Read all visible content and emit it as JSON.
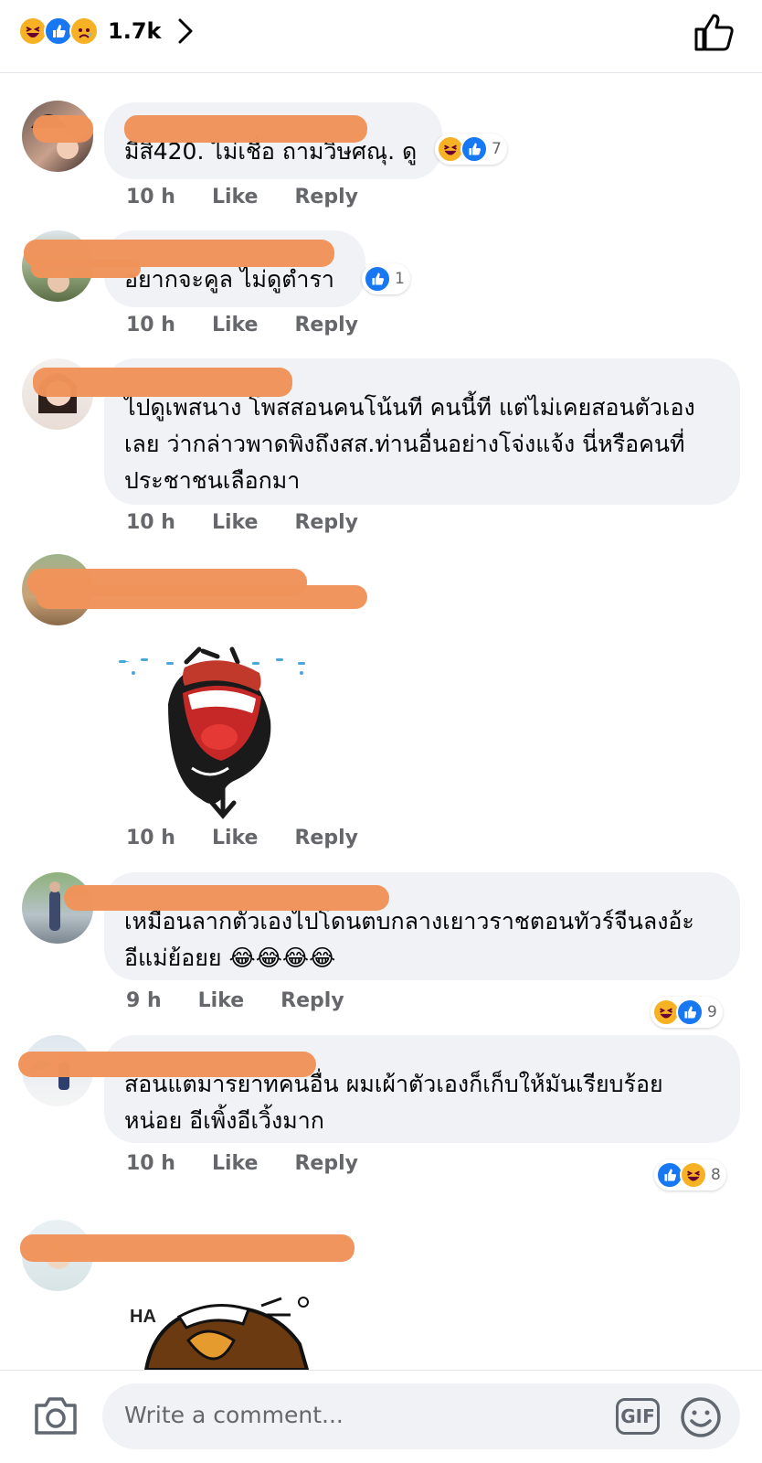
{
  "header": {
    "reaction_icons": [
      "haha-icon",
      "like-icon",
      "sad-icon"
    ],
    "reaction_count": "1.7k"
  },
  "comments": [
    {
      "text": "มีสิ420. ไม่เชื่อ ถามวิษศณุ. ดู",
      "time": "10 h",
      "like": "Like",
      "reply": "Reply",
      "reactions": [
        "haha-icon",
        "like-icon"
      ],
      "reaction_count": "7"
    },
    {
      "text": "อยากจะคูล ไม่ดูตำรา",
      "time": "10 h",
      "like": "Like",
      "reply": "Reply",
      "reactions": [
        "like-icon"
      ],
      "reaction_count": "1"
    },
    {
      "text": "ไปดูเพสนาง โพสสอนคนโน้นที คนนี้ที แต่ไม่เคยสอนตัวเอง\nเลย ว่ากล่าวพาดพิงถึงสส.ท่านอื่นอย่างโจ่งแจ้ง นี่หรือคนที่\nประชาชนเลือกมา",
      "time": "10 h",
      "like": "Like",
      "reply": "Reply"
    },
    {
      "sticker": "laughing-crying-sticker",
      "time": "10 h",
      "like": "Like",
      "reply": "Reply"
    },
    {
      "text": "เหมือนลากตัวเองไปโดนตบกลางเยาวราชตอนทัวร์จีนลงอ้ะ\nอีแม่ย้อยย 😂😂😂😂",
      "time": "9 h",
      "like": "Like",
      "reply": "Reply",
      "reactions": [
        "haha-icon",
        "like-icon"
      ],
      "reaction_count": "9"
    },
    {
      "text": "สอนแต่มารยาทคนอื่น ผมเผ้าตัวเองก็เก็บให้มันเรียบร้อย\nหน่อย อีเพิ้งอีเวิ้งมาก",
      "time": "10 h",
      "like": "Like",
      "reply": "Reply",
      "reactions": [
        "like-icon",
        "haha-icon"
      ],
      "reaction_count": "8"
    },
    {
      "sticker": "ha-laughing-sticker",
      "sticker_text": "HA"
    }
  ],
  "composer": {
    "placeholder": "Write a comment...",
    "gif_label": "GIF"
  },
  "colors": {
    "like_blue": "#1877f2",
    "haha_yellow": "#f7b125",
    "bubble_gray": "#f0f2f5",
    "meta_gray": "#65676b",
    "redaction_orange": "#f0935a"
  }
}
